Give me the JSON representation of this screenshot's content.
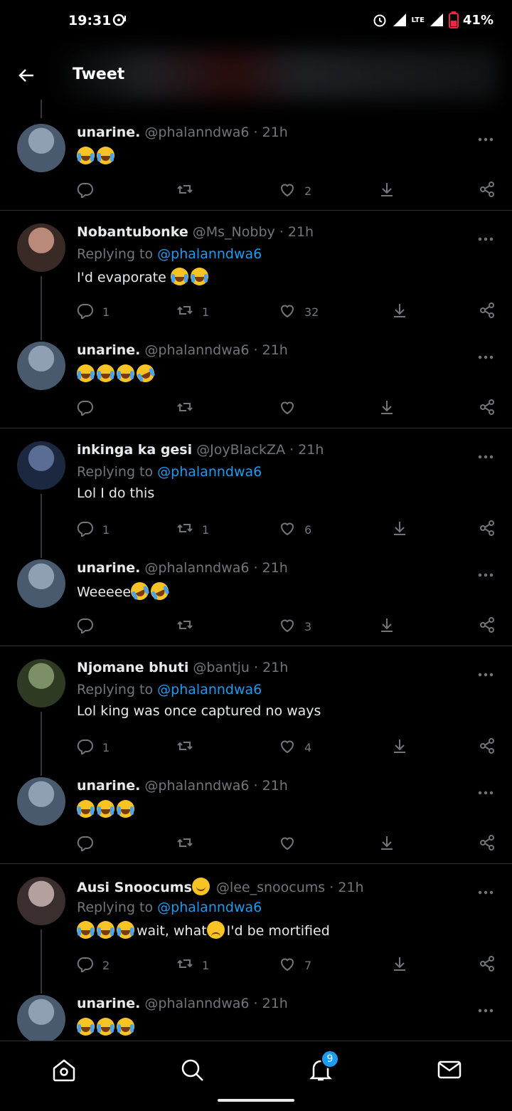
{
  "status_bar": {
    "time": "19:31",
    "network": "LTE",
    "battery": "41%"
  },
  "header": {
    "title": "Tweet"
  },
  "tweets": [
    {
      "name": "unarine.",
      "handle": "@phalanndwa6 · 21h",
      "replying_label": "",
      "replying_to": "",
      "text": "",
      "emoji": [
        "joy",
        "joy"
      ],
      "replies": "",
      "retweets": "",
      "likes": "2"
    },
    {
      "name": "Nobantubonke",
      "handle": "@Ms_Nobby · 21h",
      "replying_label": "Replying to",
      "replying_to": "@phalanndwa6",
      "text": "I'd evaporate ",
      "emoji": [
        "sob",
        "sob"
      ],
      "replies": "1",
      "retweets": "1",
      "likes": "32"
    },
    {
      "name": "unarine.",
      "handle": "@phalanndwa6 · 21h",
      "replying_label": "",
      "replying_to": "",
      "text": "",
      "emoji": [
        "sob",
        "sob",
        "sob",
        "rofl"
      ],
      "replies": "",
      "retweets": "",
      "likes": ""
    },
    {
      "name": "inkinga ka gesi",
      "handle": "@JoyBlackZA · 21h",
      "replying_label": "Replying to",
      "replying_to": "@phalanndwa6",
      "text": "Lol I do this",
      "emoji": [],
      "replies": "1",
      "retweets": "1",
      "likes": "6"
    },
    {
      "name": "unarine.",
      "handle": "@phalanndwa6 · 21h",
      "replying_label": "",
      "replying_to": "",
      "text": "Weeeee",
      "emoji": [
        "rofl",
        "rofl"
      ],
      "replies": "",
      "retweets": "",
      "likes": "3"
    },
    {
      "name": "Njomane bhuti",
      "handle": "@bantju · 21h",
      "replying_label": "Replying to",
      "replying_to": "@phalanndwa6",
      "text": "Lol king was once captured no ways",
      "emoji": [],
      "replies": "1",
      "retweets": "",
      "likes": "4"
    },
    {
      "name": "unarine.",
      "handle": "@phalanndwa6 · 21h",
      "replying_label": "",
      "replying_to": "",
      "text": "",
      "emoji": [
        "joy",
        "joy",
        "joy"
      ],
      "replies": "",
      "retweets": "",
      "likes": ""
    },
    {
      "name": "Ausi Snoocums",
      "handle": "@lee_snoocums · 21h",
      "replying_label": "Replying to",
      "replying_to": "@phalanndwa6",
      "text_parts": [
        "wait, what",
        "I'd be mortified"
      ],
      "emoji": [
        "sob",
        "sob",
        "sob"
      ],
      "replies": "2",
      "retweets": "1",
      "likes": "7"
    },
    {
      "name": "unarine.",
      "handle": "@phalanndwa6 · 21h",
      "replying_label": "",
      "replying_to": "",
      "text": "",
      "emoji": [
        "sob",
        "sob",
        "sob"
      ],
      "replies": "",
      "retweets": "",
      "likes": ""
    }
  ],
  "bottom_nav": {
    "items": [
      "home-icon",
      "search-icon",
      "notifications-icon",
      "messages-icon"
    ],
    "notification_count": "9"
  },
  "colors": {
    "background": "#000000",
    "accent": "#1d9bf0",
    "muted": "#71767b",
    "text": "#e7e9ea"
  }
}
